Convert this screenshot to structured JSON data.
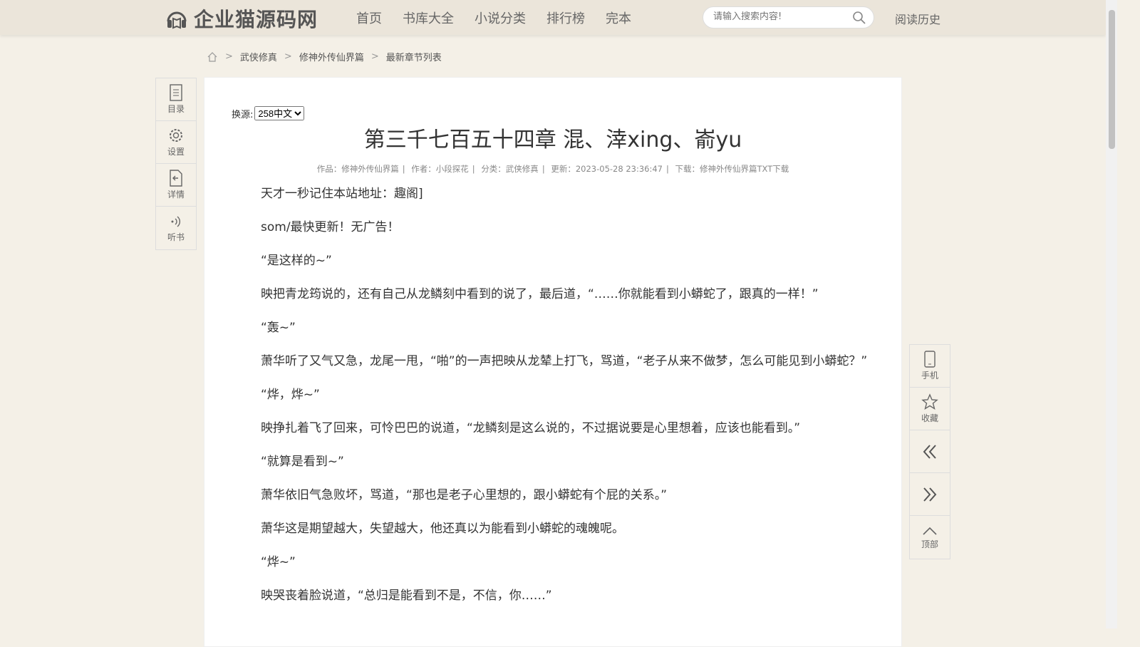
{
  "header": {
    "site_name": "企业猫源码网",
    "nav": [
      "首页",
      "书库大全",
      "小说分类",
      "排行榜",
      "完本"
    ],
    "search_placeholder": "请输入搜索内容!",
    "history": "阅读历史"
  },
  "breadcrumb": {
    "items": [
      "武侠修真",
      "修神外传仙界篇",
      "最新章节列表"
    ],
    "sep": ">"
  },
  "chapter": {
    "source_label": "换源:",
    "source_selected": "258中文",
    "title": "第三千七百五十四章 混、涬xing、嵛yu",
    "meta": [
      "作品：修神外传仙界篇",
      "作者：小段探花",
      "分类：武侠修真",
      "更新：2023-05-28 23:36:47",
      "下载：修神外传仙界篇TXT下载"
    ],
    "meta_sep": "|",
    "paragraphs": [
      "天才一秒记住本站地址：趣阁]",
      "som/最快更新！无广告！",
      "“是这样的~”",
      "映把青龙筠说的，还有自己从龙鳞刻中看到的说了，最后道，“……你就能看到小蟒蛇了，跟真的一样！”",
      "“轰~”",
      "萧华听了又气又急，龙尾一甩，“啪”的一声把映从龙辇上打飞，骂道，“老子从来不做梦，怎么可能见到小蟒蛇？”",
      "“烨，烨~”",
      "映挣扎着飞了回来，可怜巴巴的说道，“龙鳞刻是这么说的，不过据说要是心里想着，应该也能看到。”",
      "“就算是看到~”",
      "萧华依旧气急败坏，骂道，“那也是老子心里想的，跟小蟒蛇有个屁的关系。”",
      "萧华这是期望越大，失望越大，他还真以为能看到小蟒蛇的魂魄呢。",
      "“烨~”",
      "映哭丧着脸说道，“总归是能看到不是，不信，你……”"
    ]
  },
  "left_toolbar": [
    "目录",
    "设置",
    "详情",
    "听书"
  ],
  "right_toolbar": {
    "phone": "手机",
    "fav": "收藏",
    "top": "顶部"
  }
}
